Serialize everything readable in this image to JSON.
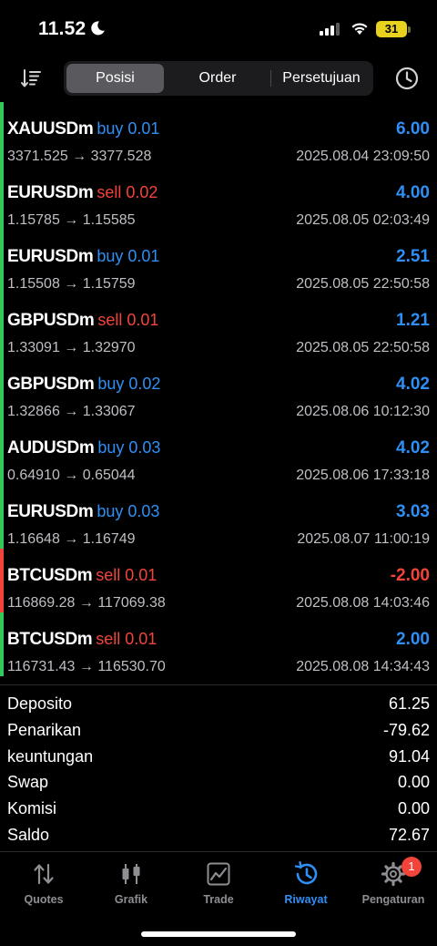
{
  "status_bar": {
    "time": "11.52",
    "battery": "31"
  },
  "toolbar": {
    "tabs": [
      {
        "label": "Posisi",
        "active": true
      },
      {
        "label": "Order",
        "active": false
      },
      {
        "label": "Persetujuan",
        "active": false
      }
    ]
  },
  "trades": [
    {
      "symbol": "XAUUSDm",
      "side": "buy 0.01",
      "profit": "6.00",
      "prices": "3371.525 → 3377.528",
      "time": "2025.08.04 23:09:50",
      "bar_color": "#34c759",
      "side_color": "#2f8ff5",
      "profit_color": "#2f8ff5"
    },
    {
      "symbol": "EURUSDm",
      "side": "sell 0.02",
      "profit": "4.00",
      "prices": "1.15785 → 1.15585",
      "time": "2025.08.05 02:03:49",
      "bar_color": "#34c759",
      "side_color": "#f2443a",
      "profit_color": "#2f8ff5"
    },
    {
      "symbol": "EURUSDm",
      "side": "buy 0.01",
      "profit": "2.51",
      "prices": "1.15508 → 1.15759",
      "time": "2025.08.05 22:50:58",
      "bar_color": "#34c759",
      "side_color": "#2f8ff5",
      "profit_color": "#2f8ff5"
    },
    {
      "symbol": "GBPUSDm",
      "side": "sell 0.01",
      "profit": "1.21",
      "prices": "1.33091 → 1.32970",
      "time": "2025.08.05 22:50:58",
      "bar_color": "#34c759",
      "side_color": "#f2443a",
      "profit_color": "#2f8ff5"
    },
    {
      "symbol": "GBPUSDm",
      "side": "buy 0.02",
      "profit": "4.02",
      "prices": "1.32866 → 1.33067",
      "time": "2025.08.06 10:12:30",
      "bar_color": "#34c759",
      "side_color": "#2f8ff5",
      "profit_color": "#2f8ff5"
    },
    {
      "symbol": "AUDUSDm",
      "side": "buy 0.03",
      "profit": "4.02",
      "prices": "0.64910 → 0.65044",
      "time": "2025.08.06 17:33:18",
      "bar_color": "#34c759",
      "side_color": "#2f8ff5",
      "profit_color": "#2f8ff5"
    },
    {
      "symbol": "EURUSDm",
      "side": "buy 0.03",
      "profit": "3.03",
      "prices": "1.16648 → 1.16749",
      "time": "2025.08.07 11:00:19",
      "bar_color": "#34c759",
      "side_color": "#2f8ff5",
      "profit_color": "#2f8ff5"
    },
    {
      "symbol": "BTCUSDm",
      "side": "sell 0.01",
      "profit": "-2.00",
      "prices": "116869.28 → 117069.38",
      "time": "2025.08.08 14:03:46",
      "bar_color": "#f2443a",
      "side_color": "#f2443a",
      "profit_color": "#f2443a"
    },
    {
      "symbol": "BTCUSDm",
      "side": "sell 0.01",
      "profit": "2.00",
      "prices": "116731.43 → 116530.70",
      "time": "2025.08.08 14:34:43",
      "bar_color": "#34c759",
      "side_color": "#f2443a",
      "profit_color": "#2f8ff5"
    }
  ],
  "summary": [
    {
      "label": "Deposito",
      "value": "61.25"
    },
    {
      "label": "Penarikan",
      "value": "-79.62"
    },
    {
      "label": "keuntungan",
      "value": "91.04"
    },
    {
      "label": "Swap",
      "value": "0.00"
    },
    {
      "label": "Komisi",
      "value": "0.00"
    },
    {
      "label": "Saldo",
      "value": "72.67"
    }
  ],
  "tab_bar": {
    "tabs": [
      {
        "label": "Quotes",
        "icon": "quotes-arrows-icon",
        "active": false
      },
      {
        "label": "Grafik",
        "icon": "candlestick-icon",
        "active": false
      },
      {
        "label": "Trade",
        "icon": "trade-chart-icon",
        "active": false
      },
      {
        "label": "Riwayat",
        "icon": "history-icon",
        "active": true
      },
      {
        "label": "Pengaturan",
        "icon": "gear-icon",
        "active": false,
        "badge": "1"
      }
    ]
  },
  "colors": {
    "accent": "#2f8ff5",
    "loss": "#f2443a",
    "profit_bar": "#34c759"
  }
}
